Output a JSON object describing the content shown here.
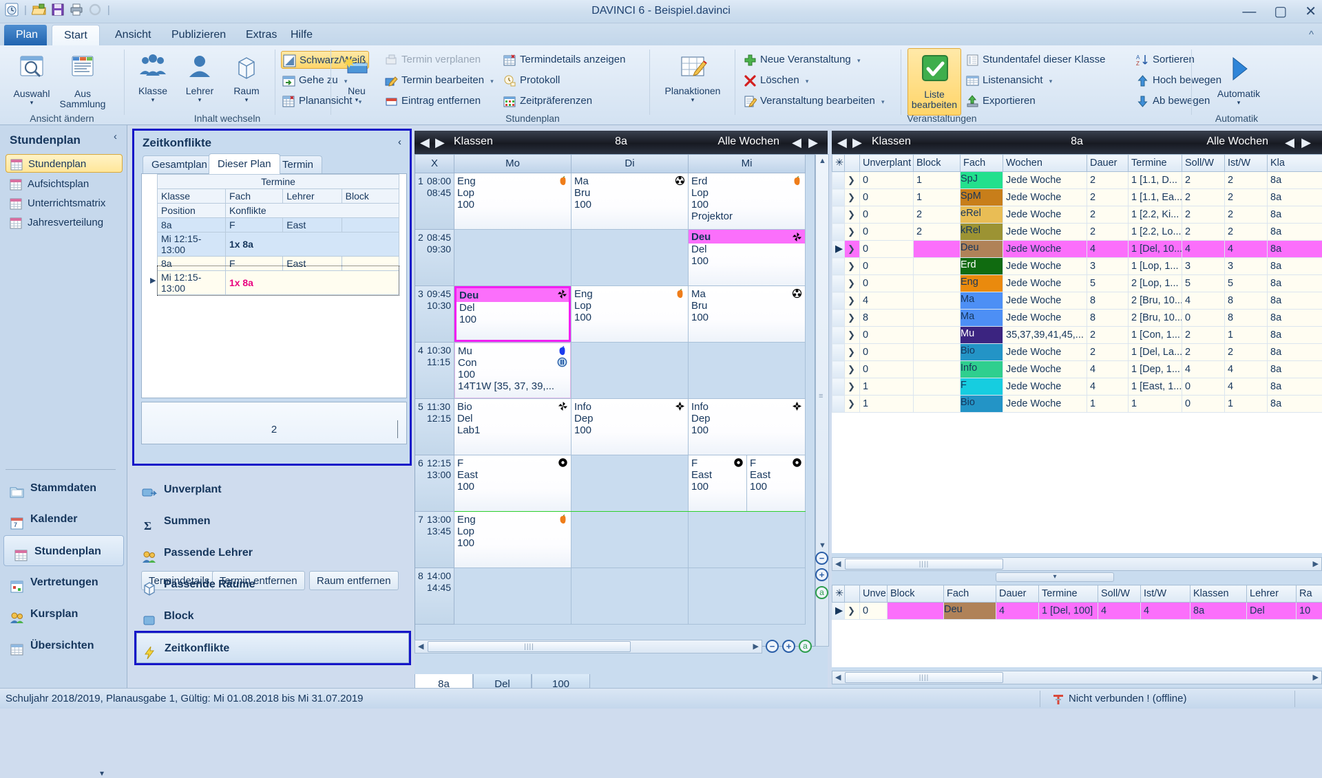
{
  "window": {
    "title": "DAVINCI 6 - Beispiel.davinci",
    "quick_access": [
      "plan-icon",
      "open-folder-icon",
      "save-icon",
      "print-icon",
      "refresh-icon"
    ],
    "buttons": {
      "minimize": "—",
      "maximize": "▢",
      "close": "✕"
    },
    "help_caret": "^"
  },
  "menu": {
    "tabs": [
      {
        "label": "Plan",
        "style": "blue"
      },
      {
        "label": "Start",
        "style": "active"
      },
      {
        "label": "Ansicht",
        "style": "normal"
      },
      {
        "label": "Publizieren",
        "style": "normal"
      },
      {
        "label": "Extras",
        "style": "normal"
      },
      {
        "label": "Hilfe",
        "style": "normal"
      }
    ]
  },
  "ribbon": {
    "groups": [
      {
        "label": "Ansicht ändern"
      },
      {
        "label": "Inhalt wechseln"
      },
      {
        "label": "Stundenplan"
      },
      {
        "label": "Veranstaltungen"
      },
      {
        "label": "Automatik"
      }
    ],
    "big_buttons": {
      "auswahl": "Auswahl",
      "aus_sammlung_1": "Aus",
      "aus_sammlung_2": "Sammlung",
      "klasse": "Klasse",
      "lehrer": "Lehrer",
      "raum": "Raum",
      "neu": "Neu",
      "planaktionen": "Planaktionen",
      "liste_bearbeiten_1": "Liste",
      "liste_bearbeiten_2": "bearbeiten",
      "automatik": "Automatik"
    },
    "small_buttons": {
      "schwarz_weiss": "Schwarz/Weiß",
      "gehe_zu": "Gehe zu",
      "planansicht": "Planansicht",
      "termin_verplanen": "Termin verplanen",
      "termin_bearbeiten": "Termin bearbeiten",
      "eintrag_entfernen": "Eintrag entfernen",
      "termindetails_anzeigen": "Termindetails anzeigen",
      "protokoll": "Protokoll",
      "zeitpraeferenzen": "Zeitpräferenzen",
      "neue_veranstaltung": "Neue Veranstaltung",
      "loeschen": "Löschen",
      "veranstaltung_bearbeiten": "Veranstaltung bearbeiten",
      "stundentafel": "Stundentafel dieser Klasse",
      "listenansicht": "Listenansicht",
      "exportieren": "Exportieren",
      "sortieren": "Sortieren",
      "hoch_bewegen": "Hoch bewegen",
      "ab_bewegen": "Ab bewegen"
    }
  },
  "left_nav": {
    "header": "Stundenplan",
    "collapse_glyph": "‹",
    "items": [
      {
        "label": "Stundenplan",
        "selected": true
      },
      {
        "label": "Aufsichtsplan",
        "selected": false
      },
      {
        "label": "Unterrichtsmatrix",
        "selected": false
      },
      {
        "label": "Jahresverteilung",
        "selected": false
      }
    ],
    "sections": [
      {
        "label": "Stammdaten",
        "icon": "folder-icon",
        "selected": false
      },
      {
        "label": "Kalender",
        "icon": "calendar-icon",
        "selected": false
      },
      {
        "label": "Stundenplan",
        "icon": "grid-icon",
        "selected": true
      },
      {
        "label": "Vertretungen",
        "icon": "substitution-icon",
        "selected": false
      },
      {
        "label": "Kursplan",
        "icon": "people-icon",
        "selected": false
      },
      {
        "label": "Übersichten",
        "icon": "overview-icon",
        "selected": false
      }
    ],
    "scroll_down_glyph": "▾"
  },
  "zeitkonflikte": {
    "title": "Zeitkonflikte",
    "collapse_glyph": "‹",
    "tabs": [
      {
        "label": "Gesamtplan",
        "active": false
      },
      {
        "label": "Dieser Plan",
        "active": true
      },
      {
        "label": "Termin",
        "active": false
      }
    ],
    "group_header": "Termine",
    "columns": [
      "Klasse",
      "Fach",
      "Lehrer",
      "Block"
    ],
    "subheader": {
      "position": "Position",
      "konflikte": "Konflikte"
    },
    "rows": [
      {
        "klasse": "8a",
        "fach": "F",
        "lehrer": "East",
        "block": "",
        "position": "Mi 12:15-13:00",
        "konflikte": "1x 8a",
        "conflict_highlight": false,
        "selected": true
      },
      {
        "klasse": "8a",
        "fach": "F",
        "lehrer": "East",
        "block": "",
        "position": "Mi 12:15-13:00",
        "konflikte": "1x 8a",
        "conflict_highlight": true,
        "selected": false
      }
    ],
    "count": "2",
    "buttons": [
      "Termindetails",
      "Termin entfernen",
      "Raum entfernen"
    ]
  },
  "plan_options": {
    "items": [
      {
        "label": "Unverplant",
        "icon": "unplanned-icon",
        "selected": false
      },
      {
        "label": "Summen",
        "icon": "sigma-icon",
        "selected": false
      },
      {
        "label": "Passende Lehrer",
        "icon": "people-icon",
        "selected": false
      },
      {
        "label": "Passende Räume",
        "icon": "cube-icon",
        "selected": false
      },
      {
        "label": "Block",
        "icon": "block-icon",
        "selected": false
      },
      {
        "label": "Zeitkonflikte",
        "icon": "lightning-icon",
        "selected": true
      }
    ]
  },
  "timetable": {
    "header": {
      "scope": "Klassen",
      "value": "8a",
      "weeks": "Alle Wochen"
    },
    "corner": "X",
    "days": [
      "Mo",
      "Di",
      "Mi"
    ],
    "periods": [
      {
        "num": "1",
        "from": "08:00",
        "to": "08:45"
      },
      {
        "num": "2",
        "from": "08:45",
        "to": "09:30"
      },
      {
        "num": "3",
        "from": "09:45",
        "to": "10:30"
      },
      {
        "num": "4",
        "from": "10:30",
        "to": "11:15"
      },
      {
        "num": "5",
        "from": "11:30",
        "to": "12:15"
      },
      {
        "num": "6",
        "from": "12:15",
        "to": "13:00"
      },
      {
        "num": "7",
        "from": "13:00",
        "to": "13:45"
      },
      {
        "num": "8",
        "from": "14:00",
        "to": "14:45"
      }
    ],
    "lessons": [
      {
        "period": 1,
        "day": 0,
        "subject": "Eng",
        "teacher": "Lop",
        "room": "100",
        "extra": "",
        "badge": "apple-orange-icon",
        "state": "normal"
      },
      {
        "period": 1,
        "day": 1,
        "subject": "Ma",
        "teacher": "Bru",
        "room": "100",
        "extra": "",
        "badge": "flower-black-icon",
        "state": "normal"
      },
      {
        "period": 1,
        "day": 2,
        "subject": "Erd",
        "teacher": "Lop",
        "room": "100",
        "extra": "Projektor",
        "badge": "apple-orange-icon",
        "state": "normal"
      },
      {
        "period": 2,
        "day": 2,
        "subject": "Deu",
        "teacher": "Del",
        "room": "100",
        "extra": "",
        "badge": "pinwheel-icon",
        "state": "pink-bar"
      },
      {
        "period": 3,
        "day": 0,
        "subject": "Deu",
        "teacher": "Del",
        "room": "100",
        "extra": "",
        "badge": "pinwheel-icon",
        "state": "selected-pink"
      },
      {
        "period": 3,
        "day": 1,
        "subject": "Eng",
        "teacher": "Lop",
        "room": "100",
        "extra": "",
        "badge": "apple-orange-icon",
        "state": "normal"
      },
      {
        "period": 3,
        "day": 2,
        "subject": "Ma",
        "teacher": "Bru",
        "room": "100",
        "extra": "",
        "badge": "flower-black-icon",
        "state": "normal"
      },
      {
        "period": 4,
        "day": 0,
        "subject": "Mu",
        "teacher": "Con",
        "room": "100",
        "extra": "14T1W [35, 37, 39,...",
        "badge": "apple-blue-icon",
        "badge2": "pause-icon",
        "state": "lilac"
      },
      {
        "period": 5,
        "day": 0,
        "subject": "Bio",
        "teacher": "Del",
        "room": "Lab1",
        "extra": "",
        "badge": "pinwheel-icon",
        "state": "normal"
      },
      {
        "period": 5,
        "day": 1,
        "subject": "Info",
        "teacher": "Dep",
        "room": "100",
        "extra": "",
        "badge": "diamond-icon",
        "state": "normal"
      },
      {
        "period": 5,
        "day": 2,
        "subject": "Info",
        "teacher": "Dep",
        "room": "100",
        "extra": "",
        "badge": "diamond-icon",
        "state": "normal"
      },
      {
        "period": 6,
        "day": 0,
        "subject": "F",
        "teacher": "East",
        "room": "100",
        "extra": "",
        "badge": "circle-dot-icon",
        "state": "normal"
      },
      {
        "period": 6,
        "day": 2,
        "subject": "F",
        "teacher": "East",
        "room": "100",
        "extra": "",
        "badge": "circle-dot-icon",
        "state": "half-left"
      },
      {
        "period": 6,
        "day": 2.5,
        "subject": "F",
        "teacher": "East",
        "room": "100",
        "extra": "",
        "badge": "circle-dot-icon",
        "state": "half-right"
      },
      {
        "period": 7,
        "day": 0,
        "subject": "Eng",
        "teacher": "Lop",
        "room": "100",
        "extra": "",
        "badge": "apple-orange-icon",
        "state": "normal"
      }
    ],
    "bottom_tabs": [
      {
        "label": "8a",
        "active": true
      },
      {
        "label": "Del",
        "active": false
      },
      {
        "label": "100",
        "active": false
      }
    ],
    "zoom_buttons": [
      "−",
      "+",
      "a",
      "a"
    ]
  },
  "right_panel": {
    "header": {
      "scope": "Klassen",
      "value": "8a",
      "weeks": "Alle Wochen"
    },
    "columns": [
      "✳",
      "",
      "Unverplant",
      "Block",
      "Fach",
      "Wochen",
      "Dauer",
      "Termine",
      "Soll/W",
      "Ist/W",
      "Kla"
    ],
    "rows": [
      {
        "unverplant": "0",
        "block": "1",
        "fach": "SpJ",
        "fach_color": "#23e08d",
        "wochen": "Jede Woche",
        "dauer": "2",
        "termine": "1 [1.1, D...",
        "soll": "2",
        "ist": "2",
        "klassen": "8a",
        "selected": false
      },
      {
        "unverplant": "0",
        "block": "1",
        "fach": "SpM",
        "fach_color": "#c87e1a",
        "wochen": "Jede Woche",
        "dauer": "2",
        "termine": "1 [1.1, Ea...",
        "soll": "2",
        "ist": "2",
        "klassen": "8a",
        "selected": false
      },
      {
        "unverplant": "0",
        "block": "2",
        "fach": "eRel",
        "fach_color": "#e9bd55",
        "wochen": "Jede Woche",
        "dauer": "2",
        "termine": "1 [2.2, Ki...",
        "soll": "2",
        "ist": "2",
        "klassen": "8a",
        "selected": false
      },
      {
        "unverplant": "0",
        "block": "2",
        "fach": "kRel",
        "fach_color": "#9c9333",
        "wochen": "Jede Woche",
        "dauer": "2",
        "termine": "1 [2.2, Lo...",
        "soll": "2",
        "ist": "2",
        "klassen": "8a",
        "selected": false
      },
      {
        "unverplant": "0",
        "block": "",
        "fach": "Deu",
        "fach_color": "#b08258",
        "wochen": "Jede Woche",
        "dauer": "4",
        "termine": "1 [Del, 10...",
        "soll": "4",
        "ist": "4",
        "klassen": "8a",
        "selected": true
      },
      {
        "unverplant": "0",
        "block": "",
        "fach": "Erd",
        "fach_color": "#106b10",
        "wochen": "Jede Woche",
        "dauer": "3",
        "termine": "1 [Lop, 1...",
        "soll": "3",
        "ist": "3",
        "klassen": "8a",
        "selected": false
      },
      {
        "unverplant": "0",
        "block": "",
        "fach": "Eng",
        "fach_color": "#ea8a0d",
        "wochen": "Jede Woche",
        "dauer": "5",
        "termine": "2 [Lop, 1...",
        "soll": "5",
        "ist": "5",
        "klassen": "8a",
        "selected": false
      },
      {
        "unverplant": "4",
        "block": "",
        "fach": "Ma",
        "fach_color": "#4d8ff5",
        "wochen": "Jede Woche",
        "dauer": "8",
        "termine": "2 [Bru, 10...",
        "soll": "4",
        "ist": "8",
        "klassen": "8a",
        "selected": false
      },
      {
        "unverplant": "8",
        "block": "",
        "fach": "Ma",
        "fach_color": "#4d8ff5",
        "wochen": "Jede Woche",
        "dauer": "8",
        "termine": "2 [Bru, 10...",
        "soll": "0",
        "ist": "8",
        "klassen": "8a",
        "selected": false
      },
      {
        "unverplant": "0",
        "block": "",
        "fach": "Mu",
        "fach_color": "#3b2480",
        "wochen": "35,37,39,41,45,...",
        "dauer": "2",
        "termine": "1 [Con, 1...",
        "soll": "2",
        "ist": "1",
        "klassen": "8a",
        "selected": false
      },
      {
        "unverplant": "0",
        "block": "",
        "fach": "Bio",
        "fach_color": "#2394c6",
        "wochen": "Jede Woche",
        "dauer": "2",
        "termine": "1 [Del, La...",
        "soll": "2",
        "ist": "2",
        "klassen": "8a",
        "selected": false
      },
      {
        "unverplant": "0",
        "block": "",
        "fach": "Info",
        "fach_color": "#2fcf8e",
        "wochen": "Jede Woche",
        "dauer": "4",
        "termine": "1 [Dep, 1...",
        "soll": "4",
        "ist": "4",
        "klassen": "8a",
        "selected": false
      },
      {
        "unverplant": "1",
        "block": "",
        "fach": "F",
        "fach_color": "#16cde0",
        "wochen": "Jede Woche",
        "dauer": "4",
        "termine": "1 [East, 1...",
        "soll": "0",
        "ist": "4",
        "klassen": "8a",
        "selected": false
      },
      {
        "unverplant": "1",
        "block": "",
        "fach": "Bio",
        "fach_color": "#2394c6",
        "wochen": "Jede Woche",
        "dauer": "1",
        "termine": "1",
        "soll": "0",
        "ist": "1",
        "klassen": "8a",
        "selected": false
      }
    ],
    "detail_columns": [
      "✳",
      "",
      "Unve",
      "Block",
      "Fach",
      "Dauer",
      "Termine",
      "Soll/W",
      "Ist/W",
      "Klassen",
      "Lehrer",
      "Ra"
    ],
    "detail_rows": [
      {
        "unve": "0",
        "block": "",
        "fach": "Deu",
        "fach_color": "#b08258",
        "dauer": "4",
        "termine": "1 [Del, 100]",
        "soll": "4",
        "ist": "4",
        "klassen": "8a",
        "lehrer": "Del",
        "raum": "10",
        "selected": true
      }
    ]
  },
  "status_bar": {
    "left": "Schuljahr 2018/2019, Planausgabe 1, Gültig: Mi 01.08.2018 bis Mi 31.07.2019",
    "right": "Nicht verbunden ! (offline)"
  }
}
